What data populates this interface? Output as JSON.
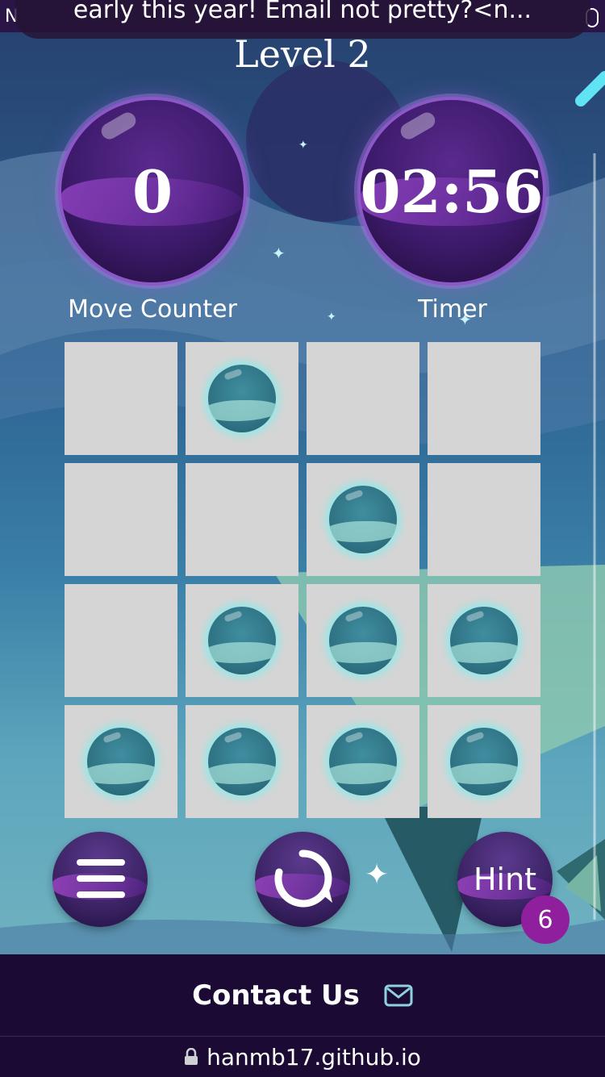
{
  "notification": {
    "text": "early this year! Email not pretty?<n..."
  },
  "level_title": "Level 2",
  "move_counter": {
    "value": "0",
    "label": "Move Counter"
  },
  "timer": {
    "value": "02:56",
    "label": "Timer"
  },
  "board": {
    "rows": 4,
    "cols": 4,
    "cells": [
      [
        false,
        true,
        false,
        false
      ],
      [
        false,
        false,
        true,
        false
      ],
      [
        false,
        true,
        true,
        true
      ],
      [
        true,
        true,
        true,
        true
      ]
    ]
  },
  "controls": {
    "menu_icon": "hamburger-menu-icon",
    "restart_icon": "restart-icon",
    "hint_label": "Hint",
    "hint_count": "6"
  },
  "footer": {
    "contact_label": "Contact Us",
    "contact_icon": "mail-icon"
  },
  "browser": {
    "url": "hanmb17.github.io",
    "lock_icon": "lock-icon"
  },
  "colors": {
    "footer_bg": "#1b0a33",
    "orb_purple": "#3d1a6b",
    "ball_teal": "#2d6f80",
    "badge": "#8f1f9c",
    "cell_bg": "#d5d5d5"
  }
}
